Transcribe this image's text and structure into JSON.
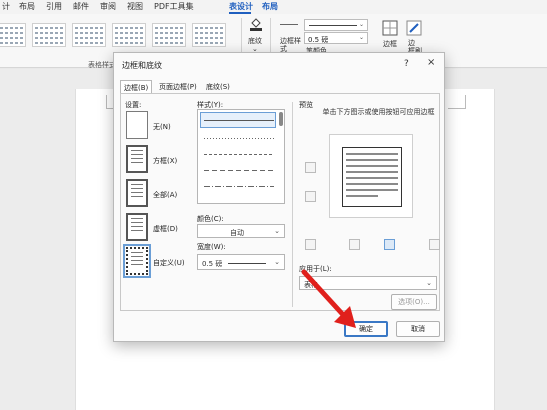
{
  "menubar": {
    "items": [
      "计",
      "布局",
      "引用",
      "邮件",
      "审阅",
      "视图",
      "PDF工具集",
      "表设计",
      "布局"
    ],
    "active_index": 7
  },
  "ribbon": {
    "table_styles_label": "表格样式",
    "shading_label": "底纹",
    "border_styles_label": "边框样\n式",
    "pen_weight": "0.5 磅",
    "pen_color_label": "笔颜色",
    "borders_label": "边框",
    "border_painter_label": "边\n框刷",
    "accent_color": "#1f5fbf"
  },
  "dialog": {
    "title": "边框和底纹",
    "help": "?",
    "close": "×",
    "tabs": [
      "边框(B)",
      "页面边框(P)",
      "底纹(S)"
    ],
    "active_tab": 0,
    "setting": {
      "heading": "设置:",
      "options": [
        "无(N)",
        "方框(X)",
        "全部(A)",
        "虚框(D)",
        "自定义(U)"
      ],
      "selected_index": 4
    },
    "style": {
      "heading": "样式(Y):"
    },
    "color": {
      "heading": "颜色(C):",
      "value": "自动"
    },
    "width": {
      "heading": "宽度(W):",
      "value": "0.5 磅"
    },
    "preview": {
      "heading": "预览",
      "hint": "单击下方图示或使用按钮可应用边框"
    },
    "apply_to": {
      "heading": "应用于(L):",
      "value": "表格"
    },
    "options_button": "选项(O)...",
    "ok_button": "确定",
    "cancel_button": "取消"
  }
}
